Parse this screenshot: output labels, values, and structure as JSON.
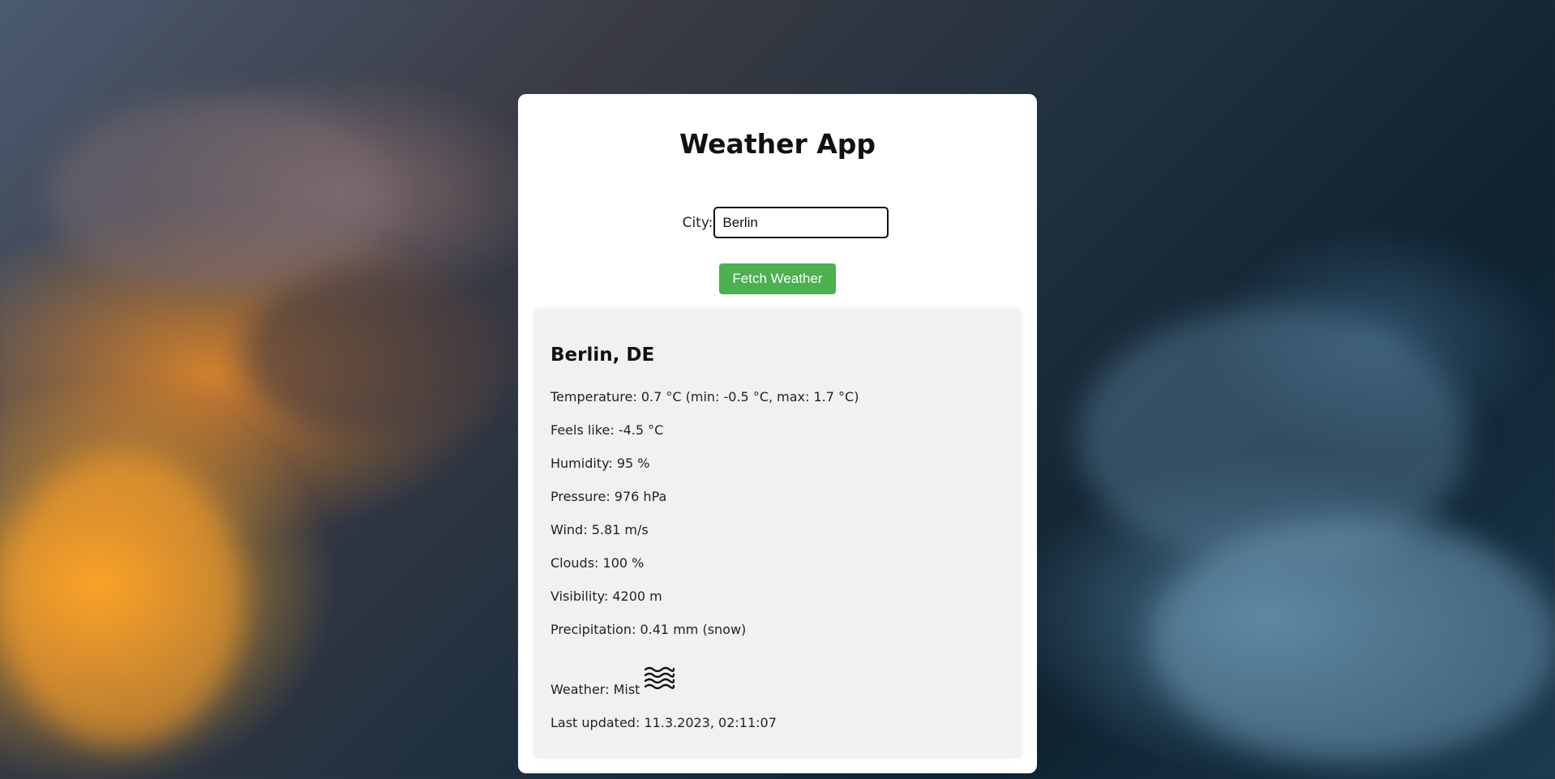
{
  "app": {
    "title": "Weather App"
  },
  "form": {
    "city_label": "City:",
    "city_value": "Berlin",
    "fetch_button_label": "Fetch Weather"
  },
  "result": {
    "location": "Berlin, DE",
    "temperature": "Temperature: 0.7 °C (min: -0.5 °C, max: 1.7 °C)",
    "feels_like": "Feels like: -4.5 °C",
    "humidity": "Humidity: 95 %",
    "pressure": "Pressure: 976 hPa",
    "wind": "Wind: 5.81 m/s",
    "clouds": "Clouds: 100 %",
    "visibility": "Visibility: 4200 m",
    "precipitation": "Precipitation: 0.41 mm (snow)",
    "weather": "Weather: Mist",
    "weather_icon": "mist-icon",
    "last_updated": "Last updated: 11.3.2023, 02:11:07"
  },
  "colors": {
    "button": "#4caf50",
    "card": "#ffffff",
    "panel": "#f1f1f1"
  }
}
